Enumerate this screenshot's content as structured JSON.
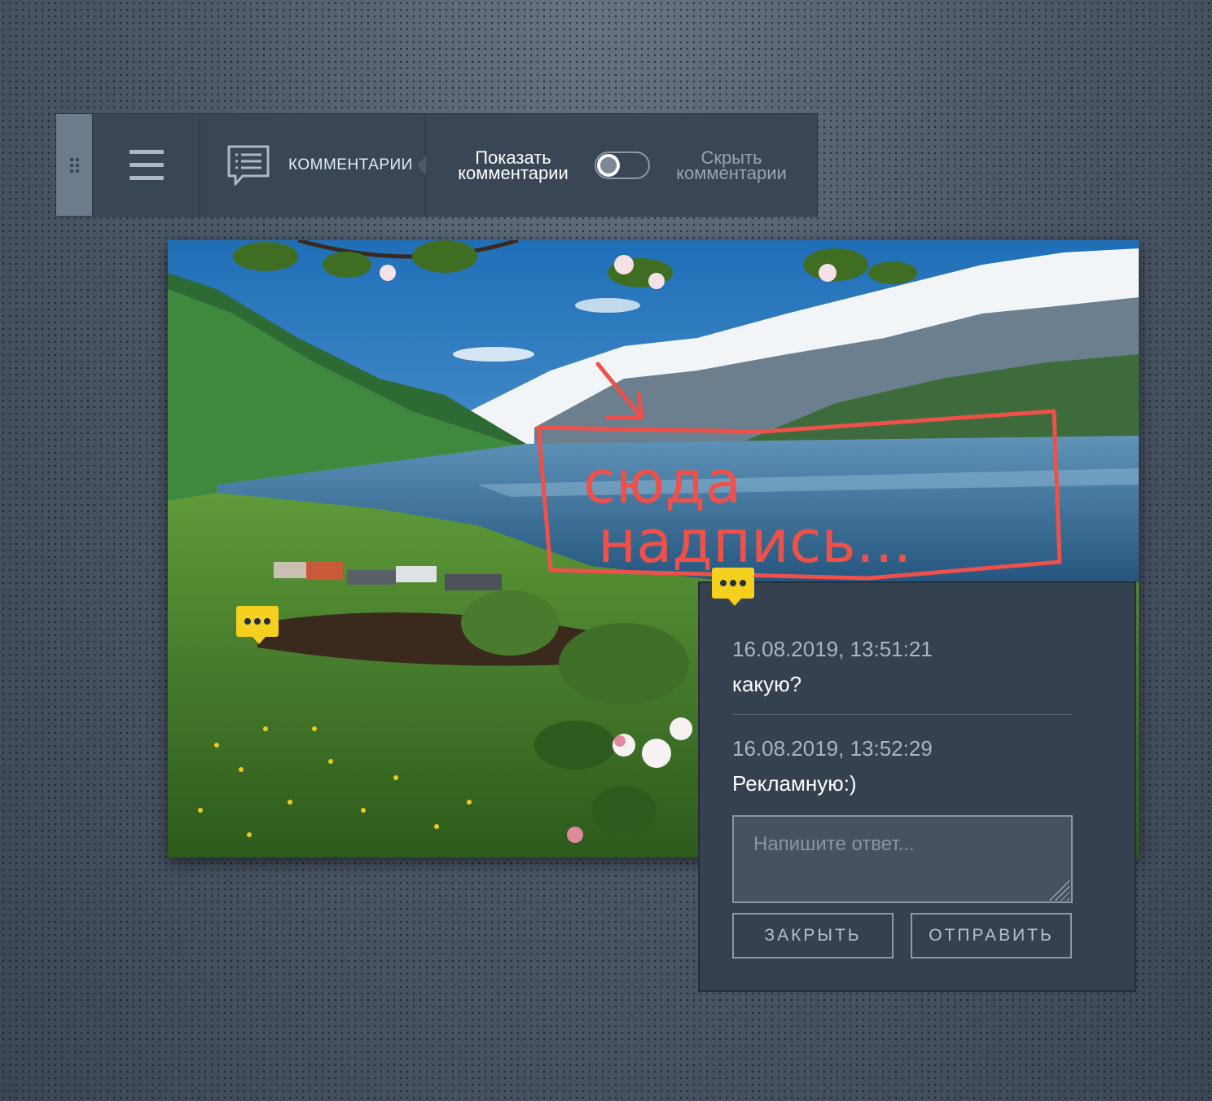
{
  "toolbar": {
    "grip_icon": "drag-handle-icon",
    "menu_icon": "hamburger-menu-icon",
    "comments_icon": "comment-list-icon",
    "comments_label": "КОММЕНТАРИИ",
    "show_comments_line1": "Показать",
    "show_comments_line2": "комментарии",
    "hide_comments_line1": "Скрыть",
    "hide_comments_line2": "комментарии",
    "toggle_state": "show"
  },
  "image": {
    "annotation_text_line1": "сюда",
    "annotation_text_line2": "надпись..."
  },
  "comment_thread": {
    "messages": [
      {
        "date": "16.08.2019, 13:51:21",
        "text": "какую?"
      },
      {
        "date": "16.08.2019, 13:52:29",
        "text": "Рекламную:)"
      }
    ],
    "reply_placeholder": "Напишите ответ...",
    "close_label": "ЗАКРЫТЬ",
    "send_label": "ОТПРАВИТЬ"
  },
  "colors": {
    "marker": "#f5d01e",
    "annotation": "#f0504a",
    "panel": "#35414f"
  }
}
